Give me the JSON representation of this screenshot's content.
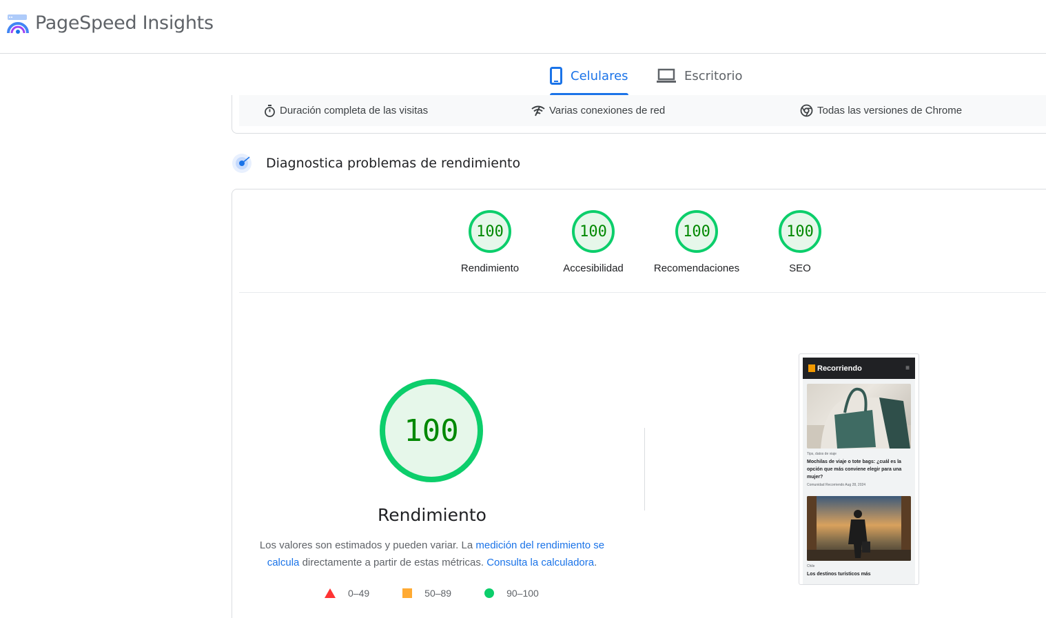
{
  "header": {
    "title": "PageSpeed Insights"
  },
  "device_tabs": {
    "mobile": "Celulares",
    "desktop": "Escritorio"
  },
  "conditions": [
    {
      "icon": "timer-icon",
      "label": "Duración completa de las visitas"
    },
    {
      "icon": "network-icon",
      "label": "Varias conexiones de red"
    },
    {
      "icon": "chrome-icon",
      "label": "Todas las versiones de Chrome"
    }
  ],
  "diagnose": {
    "title": "Diagnostica problemas de rendimiento"
  },
  "scores": [
    {
      "value": "100",
      "label": "Rendimiento"
    },
    {
      "value": "100",
      "label": "Accesibilidad"
    },
    {
      "value": "100",
      "label": "Recomendaciones"
    },
    {
      "value": "100",
      "label": "SEO"
    }
  ],
  "performance": {
    "score": "100",
    "title": "Rendimiento",
    "desc_1": "Los valores son estimados y pueden variar. La ",
    "desc_link_1": "medición del rendimiento se calcula",
    "desc_2": " directamente a partir de estas métricas. ",
    "desc_link_2": "Consulta la calculadora",
    "desc_3": "."
  },
  "legend": [
    {
      "shape": "triangle",
      "range": "0–49",
      "color": "#ff3333"
    },
    {
      "shape": "square",
      "range": "50–89",
      "color": "#ffaa33"
    },
    {
      "shape": "circle",
      "range": "90–100",
      "color": "#0cce6b"
    }
  ],
  "screenshot": {
    "brand": "Recorriendo",
    "menu": "≡",
    "post_1": {
      "category": "Tips, datos de viaje",
      "headline": "Mochilas de viaje o tote bags: ¿cuál es la opción que más conviene elegir para una mujer?",
      "meta": "Comunidad Recorriendo     Aug 28, 2024"
    },
    "post_2": {
      "category": "Chile",
      "headline": "Los destinos turísticos más"
    }
  },
  "colors": {
    "accent": "#1a73e8",
    "pass": "#0cce6b",
    "pass_text": "#008800"
  }
}
